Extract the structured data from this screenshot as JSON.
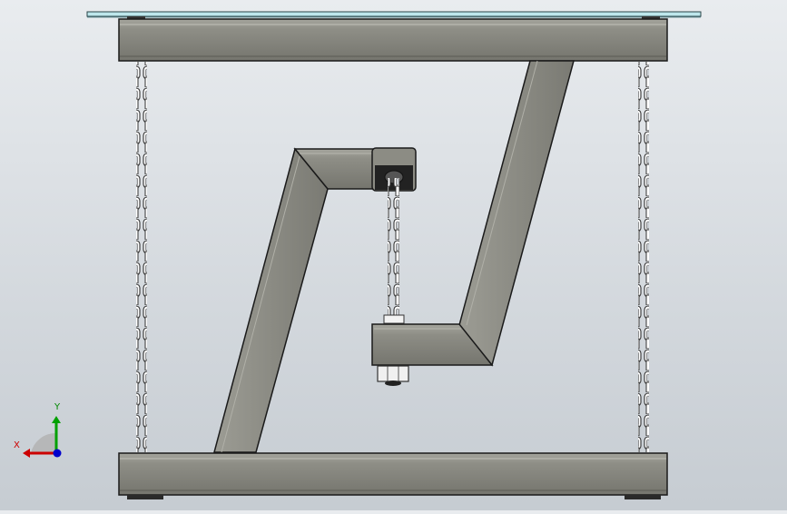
{
  "view": {
    "background": "#dfe3e7",
    "steel_color": "#8a8a82",
    "steel_dark": "#6f6f68",
    "steel_light": "#a4a49c",
    "glass_color": "#b8e4ea",
    "chain_color": "#ffffff",
    "edge_color": "#1a1a1a"
  },
  "triad": {
    "x_label": "X",
    "y_label": "Y",
    "x_color": "#cc0000",
    "y_color": "#00a000",
    "z_color": "#0000cc"
  }
}
